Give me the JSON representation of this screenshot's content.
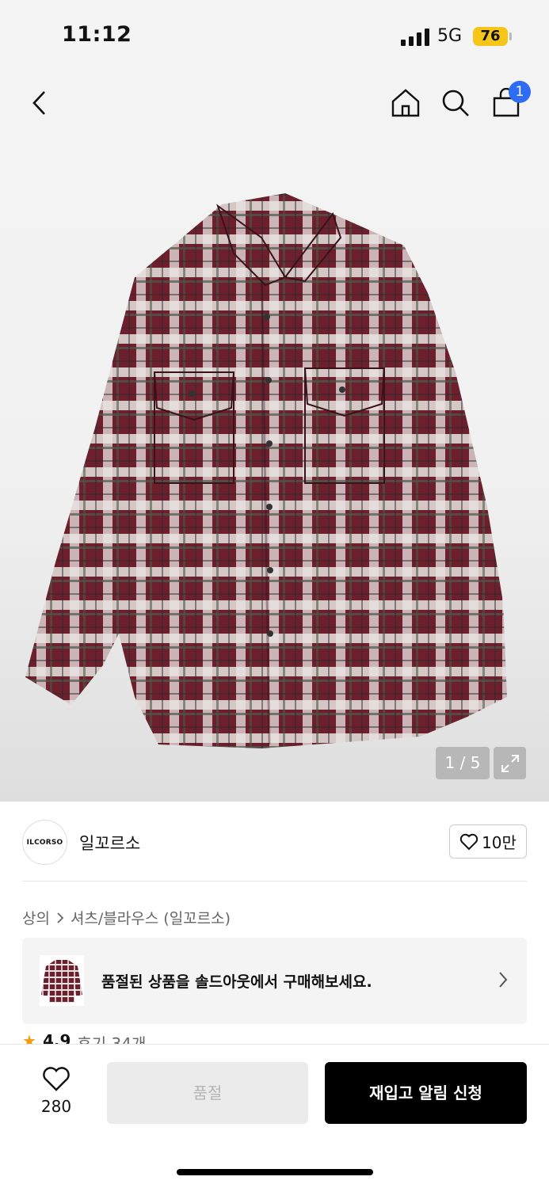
{
  "status": {
    "time": "11:12",
    "network": "5G",
    "battery": "76"
  },
  "nav": {
    "cart_count": "1"
  },
  "gallery": {
    "counter": "1 / 5"
  },
  "brand": {
    "logo_text": "ILCORSO",
    "name": "일꼬르소",
    "likes": "10만"
  },
  "breadcrumb": {
    "category": "상의",
    "subcategory": "셔츠/블라우스 (일꼬르소)"
  },
  "banner": {
    "text": "품절된 상품을 솔드아웃에서 구매해보세요."
  },
  "rating": {
    "score": "4.9",
    "reviews": "후기 34개"
  },
  "bottom": {
    "wish_count": "280",
    "soldout_label": "품절",
    "restock_label": "재입고 알림 신청"
  },
  "colors": {
    "badge": "#2f6cf6",
    "battery": "#f5c518",
    "plaid_base": "#6e1f2e"
  }
}
